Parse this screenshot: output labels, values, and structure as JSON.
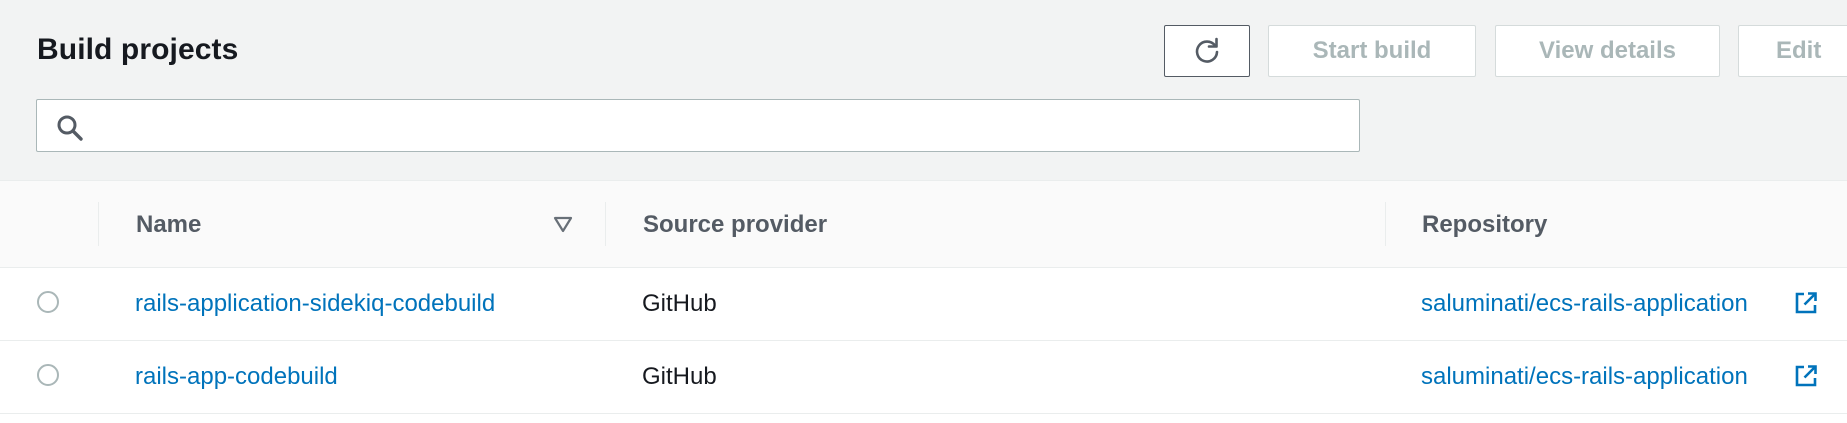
{
  "header": {
    "title": "Build projects",
    "refresh_icon": "refresh-icon",
    "start_build_label": "Start build",
    "view_details_label": "View details",
    "edit_label": "Edit"
  },
  "search": {
    "icon": "search-icon",
    "value": "",
    "placeholder": ""
  },
  "table": {
    "columns": [
      {
        "label": "Name",
        "sorted": "descending",
        "sort_icon": "sort-triangle-down-icon"
      },
      {
        "label": "Source provider"
      },
      {
        "label": "Repository"
      }
    ],
    "rows": [
      {
        "name": "rails-application-sidekiq-codebuild",
        "source_provider": "GitHub",
        "repository": "saluminati/ecs-rails-application",
        "selected": false
      },
      {
        "name": "rails-app-codebuild",
        "source_provider": "GitHub",
        "repository": "saluminati/ecs-rails-application",
        "selected": false
      }
    ],
    "external_link_icon": "external-link-icon"
  },
  "colors": {
    "link": "#0073bb",
    "header_bg": "#f2f3f3",
    "disabled_text": "#aab7b8",
    "column_header_text": "#545b64"
  }
}
